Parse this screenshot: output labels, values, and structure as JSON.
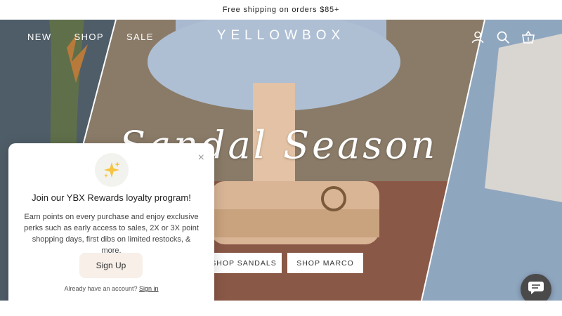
{
  "announcement": {
    "text": "Free shipping on orders $85+"
  },
  "header": {
    "nav": [
      "NEW",
      "SHOP",
      "SALE"
    ],
    "logo": "YELLOWBOX",
    "icons": [
      "account-icon",
      "search-icon",
      "cart-icon"
    ]
  },
  "hero": {
    "title": "Sandal Season",
    "buttons": [
      "SHOP SANDALS",
      "SHOP MARCO"
    ]
  },
  "popup": {
    "icon": "sparkles-icon",
    "heading": "Join our YBX Rewards loyalty program!",
    "body": "Earn points on every purchase and enjoy exclusive perks such as early access to sales, 2X or 3X point shopping days, first dibs on limited restocks, & more.",
    "signup_label": "Sign Up",
    "account_prompt": "Already have an account?",
    "signin_label": "Sign in",
    "close_glyph": "×"
  },
  "chat": {
    "icon": "chat-icon"
  }
}
